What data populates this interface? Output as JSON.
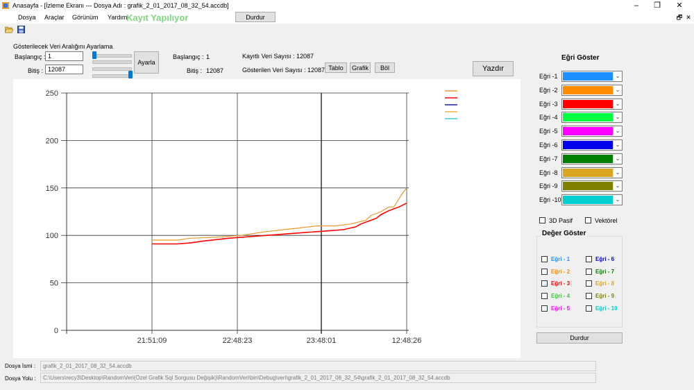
{
  "window": {
    "title": "Anasayfa - [İzleme Ekranı ---  Dosya Adı : grafik_2_01_2017_08_32_54.accdb]",
    "minimize": "–",
    "maximize": "❐",
    "close": "✕",
    "mdi_restore": "🗗",
    "mdi_close": "✕"
  },
  "menu": {
    "items": [
      "Dosya",
      "Araçlar",
      "Görünüm",
      "Yardım"
    ],
    "recording_label": "Kayıt Yapılıyor",
    "stop_button": "Durdur"
  },
  "toolbar": {
    "open_icon": "folder-open-icon",
    "save_icon": "save-icon"
  },
  "range": {
    "group_title": "Gösterilecek Veri Aralığını Ayarlama",
    "start_label": "Başlangıç :",
    "start_value": "1",
    "end_label": "Bitiş :",
    "end_value": "12087",
    "apply_button": "Ayarla",
    "start_slider": 0.0,
    "end_slider": 1.0
  },
  "info": {
    "start_label": "Başlangıç :",
    "start_value": "1",
    "end_label": "Bitiş :",
    "end_value": "12087",
    "records_text": "Kayıtlı Veri Sayısı : 12087",
    "shown_text": "Gösterilen Veri Sayısı : 12087",
    "btn_table": "Tablo",
    "btn_chart": "Grafik",
    "btn_split": "Böl",
    "btn_print": "Yazdır"
  },
  "curves": {
    "title": "Eğri Göster",
    "items": [
      {
        "label": "Eğri -1",
        "color": "#1e90ff"
      },
      {
        "label": "Eğri -2",
        "color": "#ff8c00"
      },
      {
        "label": "Eğri -3",
        "color": "#ff0000"
      },
      {
        "label": "Eğri -4",
        "color": "#00ff40"
      },
      {
        "label": "Eğri -5",
        "color": "#ff00ff"
      },
      {
        "label": "Eğri -6",
        "color": "#0000ee"
      },
      {
        "label": "Eğri -7",
        "color": "#008000"
      },
      {
        "label": "Eğri -8",
        "color": "#daa520"
      },
      {
        "label": "Eğri -9",
        "color": "#808000"
      },
      {
        "label": "Eğri -10",
        "color": "#00ced1"
      }
    ],
    "opt_3d": "3D Pasif",
    "opt_vector": "Vektörel"
  },
  "values": {
    "title": "Değer Göster",
    "items": [
      {
        "label": "Eğri - 1",
        "color": "#1e90ff"
      },
      {
        "label": "Eğri - 6",
        "color": "#0000cd"
      },
      {
        "label": "Eğri - 2",
        "color": "#ff8c00"
      },
      {
        "label": "Eğri - 7",
        "color": "#008000"
      },
      {
        "label": "Eğri - 3",
        "color": "#ff0000"
      },
      {
        "label": "Eğri - 8",
        "color": "#daa520"
      },
      {
        "label": "Eğri - 4",
        "color": "#32cd32"
      },
      {
        "label": "Eğri - 9",
        "color": "#808000"
      },
      {
        "label": "Eğri - 5",
        "color": "#ff00ff"
      },
      {
        "label": "Eğri - 10",
        "color": "#00ced1"
      }
    ],
    "stop_button": "Durdur"
  },
  "status": {
    "file_label": "Dosya İsmi :",
    "file_value": "grafik_2_01_2017_08_32_54.accdb",
    "path_label": "Dosya Yolu :",
    "path_value": "C:\\Users\\recy3\\Desktop\\RandomVeri(Özel Grafik Sql Sorgusu Değişik)\\RandomVeri\\bin\\Debug\\veri\\grafik_2_01_2017_08_32_54\\grafik_2_01_2017_08_32_54.accdb"
  },
  "chart_data": {
    "type": "line",
    "ylim": [
      0,
      250
    ],
    "yticks": [
      "0",
      "50",
      "100",
      "150",
      "200",
      "250"
    ],
    "xticks": [
      "21:51:09",
      "22:48:23",
      "23:48:01",
      "12:48:26"
    ],
    "grid": true,
    "series": [
      {
        "color": "#e89a30",
        "x": [
          0,
          0.05,
          0.1,
          0.15,
          0.25,
          0.35,
          0.45,
          0.55,
          0.65,
          0.72,
          0.78,
          0.84,
          0.86,
          0.9,
          0.93,
          0.95,
          0.98,
          1.0
        ],
        "values": [
          95,
          95,
          95,
          97,
          98,
          100,
          104,
          107,
          110,
          110,
          112,
          116,
          121,
          125,
          130,
          130,
          143,
          150
        ]
      },
      {
        "color": "#ff0000",
        "x": [
          0,
          0.05,
          0.1,
          0.15,
          0.2,
          0.3,
          0.4,
          0.5,
          0.6,
          0.7,
          0.75,
          0.8,
          0.82,
          0.85,
          0.88,
          0.9,
          0.93,
          0.95,
          0.97,
          1.0
        ],
        "values": [
          91,
          91,
          91,
          92,
          94,
          97,
          99,
          101,
          103,
          105,
          106,
          109,
          112,
          115,
          118,
          122,
          126,
          128,
          130,
          134
        ]
      }
    ]
  }
}
